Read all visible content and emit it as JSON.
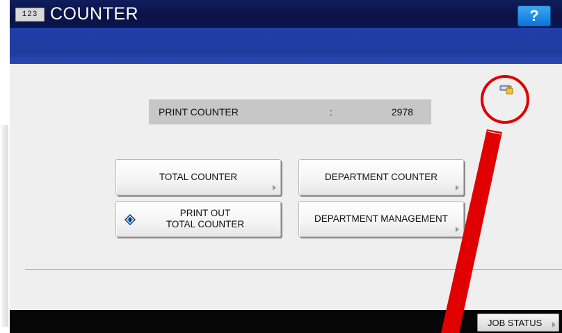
{
  "header": {
    "app_icon_text": "123",
    "title": "COUNTER",
    "help_label": "?"
  },
  "counter": {
    "label": "PRINT COUNTER",
    "separator": ":",
    "value": "2978"
  },
  "buttons": {
    "total_counter": "TOTAL COUNTER",
    "department_counter": "DEPARTMENT COUNTER",
    "print_out_line1": "PRINT OUT",
    "print_out_line2": "TOTAL COUNTER",
    "department_management": "DEPARTMENT MANAGEMENT"
  },
  "statusbar": {
    "job_status": "JOB STATUS"
  },
  "colors": {
    "title_bar": "#0a1245",
    "blue_band": "#1f3ea8",
    "help_button": "#1e88e5",
    "callout": "#e00000"
  }
}
